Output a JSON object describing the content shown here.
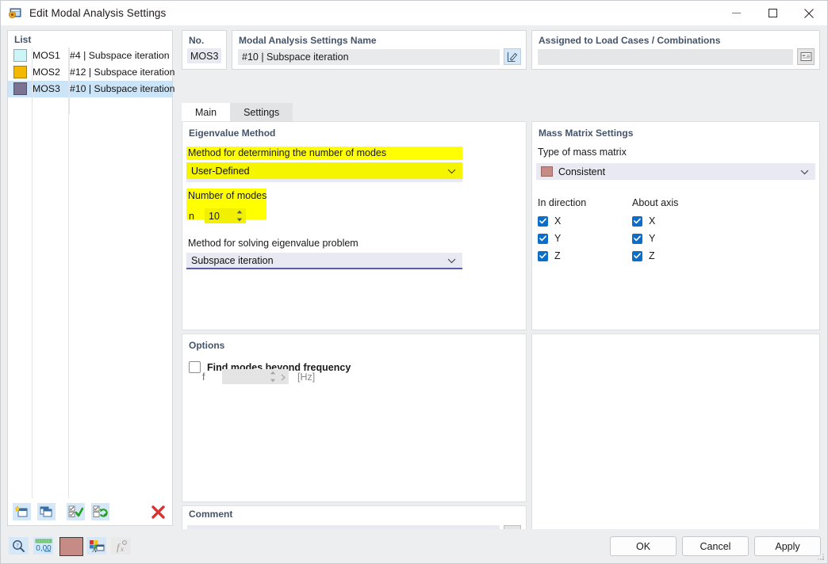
{
  "window": {
    "title": "Edit Modal Analysis Settings",
    "icon": "modal-analysis-icon",
    "minimize": "minimize-icon",
    "maximize": "maximize-icon",
    "close": "close-icon"
  },
  "list_panel": {
    "title": "List",
    "rows": [
      {
        "color": "#cdf4f7",
        "no": "MOS1",
        "description": "#4 | Subspace iteration",
        "selected": false
      },
      {
        "color": "#f5b800",
        "no": "MOS2",
        "description": "#12 | Subspace iteration",
        "selected": false
      },
      {
        "color": "#7a7392",
        "no": "MOS3",
        "description": "#10 | Subspace iteration",
        "selected": true
      }
    ],
    "toolbar": [
      {
        "name": "new-item-button",
        "icon": "new-window-star-icon"
      },
      {
        "name": "copy-item-button",
        "icon": "copy-windows-icon"
      },
      {
        "name": "select-all-button",
        "icon": "checkbox-check-icon"
      },
      {
        "name": "invert-selection-button",
        "icon": "checkbox-refresh-icon"
      },
      {
        "name": "delete-item-button",
        "icon": "red-x-icon"
      }
    ]
  },
  "header": {
    "no_label": "No.",
    "no_value": "MOS3",
    "name_label": "Modal Analysis Settings Name",
    "name_value": "#10 | Subspace iteration",
    "name_edit_icon": "pencil-edit-icon",
    "assigned_label": "Assigned to Load Cases / Combinations",
    "assigned_value": "",
    "assigned_icon": "table-select-icon"
  },
  "tabs": [
    {
      "label": "Main",
      "active": true
    },
    {
      "label": "Settings",
      "active": false
    }
  ],
  "eigenvalue_method": {
    "title": "Eigenvalue Method",
    "method_modes_label": "Method for determining the number of modes",
    "method_modes_value": "User-Defined",
    "number_of_modes_label": "Number of modes",
    "n_symbol": "n",
    "n_value": "10",
    "solve_method_label": "Method for solving eigenvalue problem",
    "solve_method_value": "Subspace iteration",
    "highlight_color": "#ffff00"
  },
  "mass_matrix": {
    "title": "Mass Matrix Settings",
    "type_label": "Type of mass matrix",
    "type_value": "Consistent",
    "type_swatch_color": "#c58b84",
    "in_direction_label": "In direction",
    "about_axis_label": "About axis",
    "in_direction": [
      {
        "label": "X",
        "checked": true
      },
      {
        "label": "Y",
        "checked": true
      },
      {
        "label": "Z",
        "checked": true
      }
    ],
    "about_axis": [
      {
        "label": "X",
        "checked": true
      },
      {
        "label": "Y",
        "checked": true
      },
      {
        "label": "Z",
        "checked": true
      }
    ],
    "check_color": "#0d6ec8"
  },
  "options": {
    "title": "Options",
    "find_modes_label": "Find modes beyond frequency",
    "find_modes_checked": false,
    "f_symbol": "f",
    "f_value": "",
    "f_unit": "[Hz]"
  },
  "comment": {
    "title": "Comment",
    "value": "",
    "copy_icon": "copy-comment-icon",
    "chevron": "chevron-down-icon"
  },
  "status_bar": {
    "icons": [
      {
        "name": "zoom-help-icon",
        "label": "magnifier"
      },
      {
        "name": "decimal-places-icon",
        "label": "0,00"
      },
      {
        "name": "color-swatch-icon",
        "label": "",
        "color": "#c58b84"
      },
      {
        "name": "label-display-icon",
        "label": ""
      },
      {
        "name": "formula-icon",
        "label": "f",
        "disabled": true
      }
    ],
    "buttons": {
      "ok": "OK",
      "cancel": "Cancel",
      "apply": "Apply"
    },
    "resize_grip": "resize-grip-icon"
  }
}
